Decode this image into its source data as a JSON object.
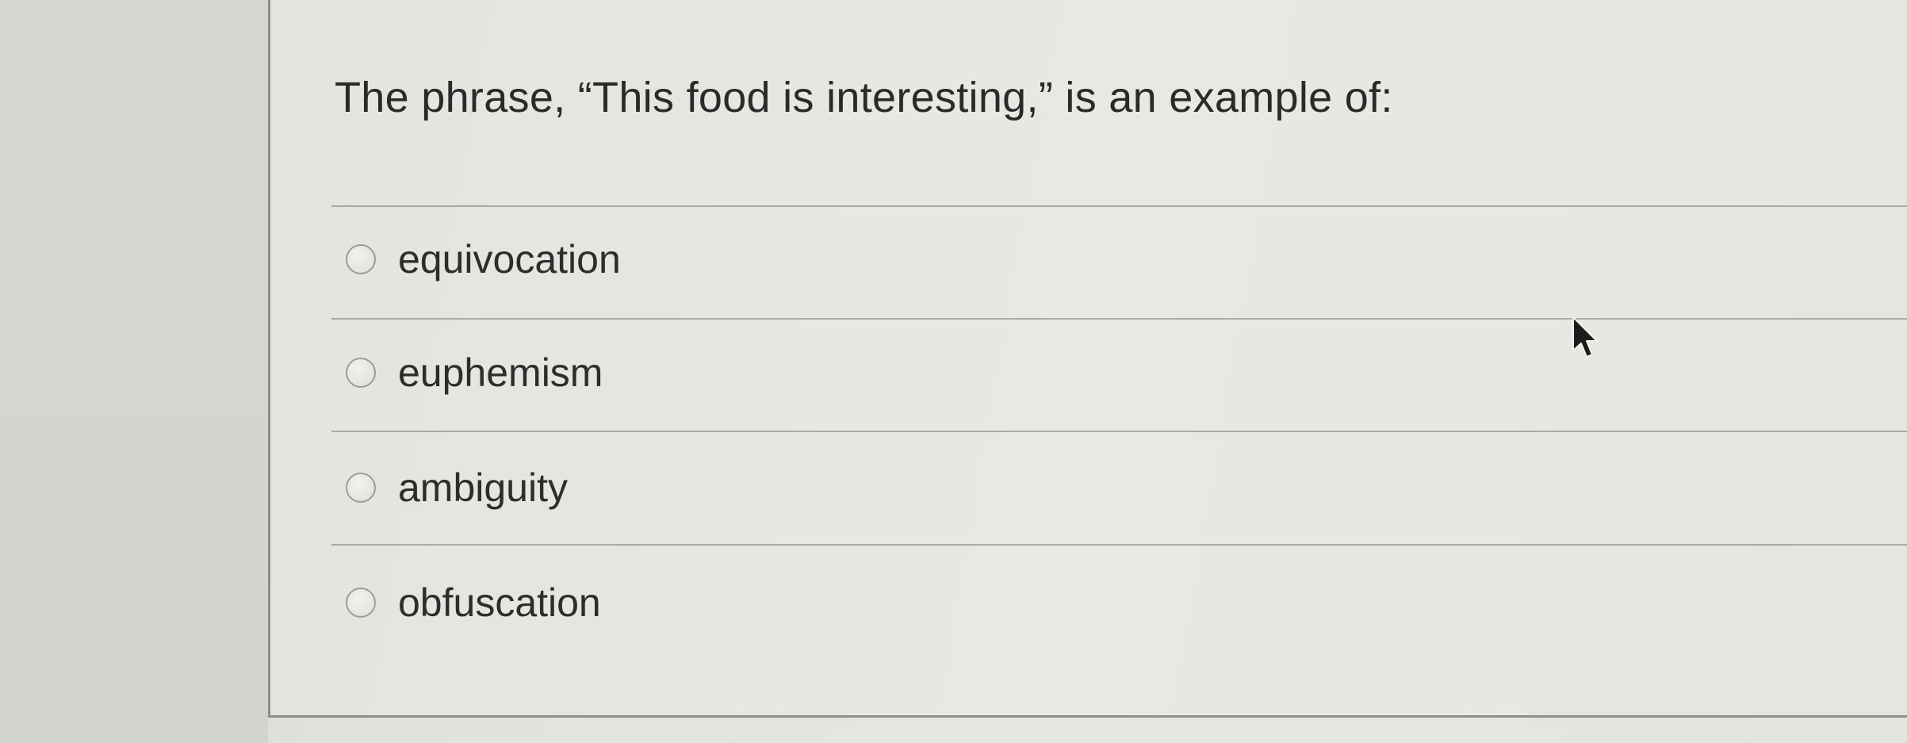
{
  "question": {
    "text": "The phrase, “This food is interesting,” is an example of:"
  },
  "options": [
    {
      "label": "equivocation",
      "selected": false
    },
    {
      "label": "euphemism",
      "selected": false
    },
    {
      "label": "ambiguity",
      "selected": false
    },
    {
      "label": "obfuscation",
      "selected": false
    }
  ],
  "icons": {
    "radio": "radio-button-icon",
    "cursor": "mouse-pointer-icon"
  }
}
